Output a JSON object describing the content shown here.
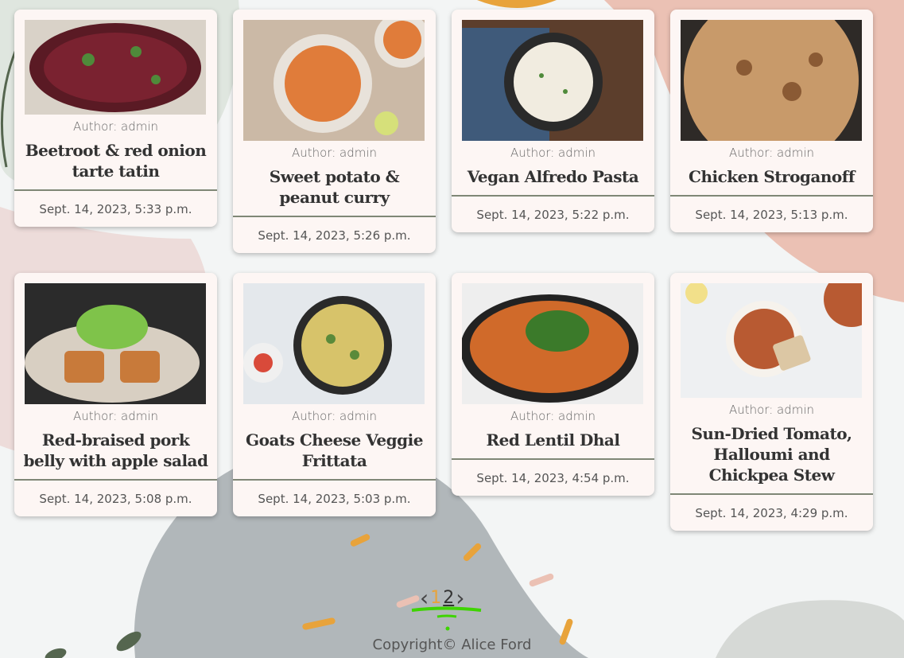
{
  "cards": [
    {
      "author": "Author: admin",
      "title": "Beetroot & red onion tarte tatin",
      "date": "Sept. 14, 2023, 5:33 p.m.",
      "image_icon": "beetroot-tart-photo"
    },
    {
      "author": "Author: admin",
      "title": "Sweet potato & peanut curry",
      "date": "Sept. 14, 2023, 5:26 p.m.",
      "image_icon": "curry-photo"
    },
    {
      "author": "Author: admin",
      "title": "Vegan Alfredo Pasta",
      "date": "Sept. 14, 2023, 5:22 p.m.",
      "image_icon": "pasta-photo"
    },
    {
      "author": "Author: admin",
      "title": "Chicken Stroganoff",
      "date": "Sept. 14, 2023, 5:13 p.m.",
      "image_icon": "stroganoff-photo"
    },
    {
      "author": "Author: admin",
      "title": "Red-braised pork belly with apple salad",
      "date": "Sept. 14, 2023, 5:08 p.m.",
      "image_icon": "pork-belly-photo"
    },
    {
      "author": "Author: admin",
      "title": "Goats Cheese Veggie Frittata",
      "date": "Sept. 14, 2023, 5:03 p.m.",
      "image_icon": "frittata-photo"
    },
    {
      "author": "Author: admin",
      "title": "Red Lentil Dhal",
      "date": "Sept. 14, 2023, 4:54 p.m.",
      "image_icon": "dhal-photo"
    },
    {
      "author": "Author: admin",
      "title": "Sun-Dried Tomato, Halloumi and Chickpea Stew",
      "date": "Sept. 14, 2023, 4:29 p.m.",
      "image_icon": "stew-photo"
    }
  ],
  "pagination": {
    "prev": "‹",
    "current": "1",
    "next_page": "2",
    "next": "›"
  },
  "footer": {
    "copyright": "Copyright© Alice Ford"
  },
  "colors": {
    "card_bg": "#fdf6f4",
    "accent": "#e8a33b",
    "divider": "#7f8776",
    "blob_pink": "#ebc1b4",
    "blob_gray": "#b1b7ba"
  }
}
